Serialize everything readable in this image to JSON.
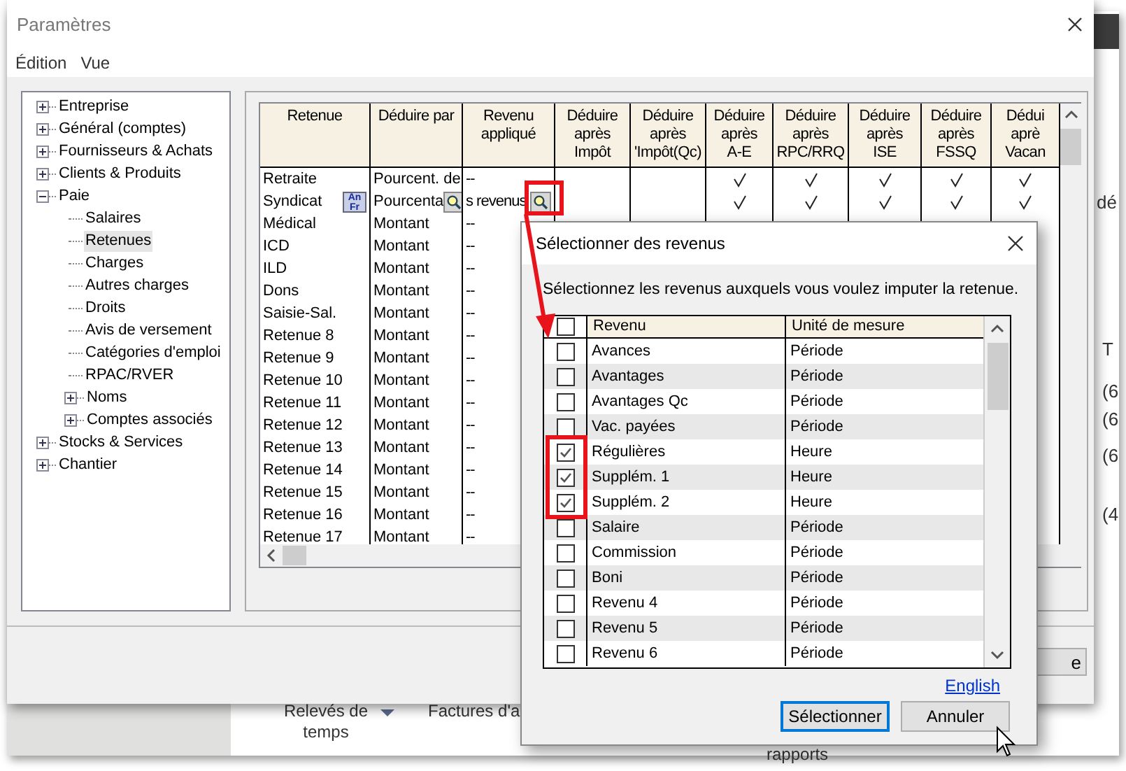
{
  "window": {
    "title": "Paramètres",
    "menu": [
      {
        "label": "Édition"
      },
      {
        "label": "Vue"
      }
    ]
  },
  "tree": [
    {
      "label": "Entreprise",
      "expanded": false,
      "selected": false
    },
    {
      "label": "Général (comptes)",
      "expanded": false,
      "selected": false
    },
    {
      "label": "Fournisseurs & Achats",
      "expanded": false,
      "selected": false
    },
    {
      "label": "Clients & Produits",
      "expanded": false,
      "selected": false
    },
    {
      "label": "Paie",
      "expanded": true,
      "selected": false,
      "children": [
        {
          "label": "Salaires",
          "selected": false
        },
        {
          "label": "Retenues",
          "selected": true
        },
        {
          "label": "Charges",
          "selected": false
        },
        {
          "label": "Autres charges",
          "selected": false
        },
        {
          "label": "Droits",
          "selected": false
        },
        {
          "label": "Avis de versement",
          "selected": false
        },
        {
          "label": "Catégories d'emploi",
          "selected": false
        },
        {
          "label": "RPAC/RVER",
          "selected": false
        },
        {
          "label": "Noms",
          "expanded": false,
          "selected": false
        },
        {
          "label": "Comptes associés",
          "expanded": false,
          "selected": false
        }
      ]
    },
    {
      "label": "Stocks & Services",
      "expanded": false,
      "selected": false
    },
    {
      "label": "Chantier",
      "expanded": false,
      "selected": false
    }
  ],
  "grid": {
    "columns": [
      [
        "Retenue"
      ],
      [
        "Déduire par"
      ],
      [
        "Revenu",
        "appliqué"
      ],
      [
        "Déduire",
        "après",
        "Impôt"
      ],
      [
        "Déduire",
        "après",
        "'Impôt(Qc)"
      ],
      [
        "Déduire",
        "après",
        "A-E"
      ],
      [
        "Déduire",
        "après",
        "RPC/RRQ"
      ],
      [
        "Déduire",
        "après",
        "ISE"
      ],
      [
        "Déduire",
        "après",
        "FSSQ"
      ],
      [
        "Dédui",
        "aprè",
        "Vacan"
      ]
    ],
    "rows": [
      {
        "retenue": "Retraite",
        "deduire_par": "Pourcent. de",
        "revenu": "--",
        "checks": [
          false,
          false,
          true,
          true,
          true,
          true,
          true
        ]
      },
      {
        "retenue": "Syndicat",
        "badge": [
          "An",
          "Fr"
        ],
        "deduire_par": "Pourcenta",
        "deduire_lookup": true,
        "revenu": "s revenus",
        "revenu_lookup": true,
        "checks": [
          false,
          false,
          true,
          true,
          true,
          true,
          true
        ]
      },
      {
        "retenue": "Médical",
        "deduire_par": "Montant",
        "revenu": "--"
      },
      {
        "retenue": "ICD",
        "deduire_par": "Montant",
        "revenu": "--"
      },
      {
        "retenue": "ILD",
        "deduire_par": "Montant",
        "revenu": "--"
      },
      {
        "retenue": "Dons",
        "deduire_par": "Montant",
        "revenu": "--"
      },
      {
        "retenue": "Saisie-Sal.",
        "deduire_par": "Montant",
        "revenu": "--"
      },
      {
        "retenue": "Retenue 8",
        "deduire_par": "Montant",
        "revenu": "--"
      },
      {
        "retenue": "Retenue 9",
        "deduire_par": "Montant",
        "revenu": "--"
      },
      {
        "retenue": "Retenue 10",
        "deduire_par": "Montant",
        "revenu": "--"
      },
      {
        "retenue": "Retenue 11",
        "deduire_par": "Montant",
        "revenu": "--"
      },
      {
        "retenue": "Retenue 12",
        "deduire_par": "Montant",
        "revenu": "--"
      },
      {
        "retenue": "Retenue 13",
        "deduire_par": "Montant",
        "revenu": "--"
      },
      {
        "retenue": "Retenue 14",
        "deduire_par": "Montant",
        "revenu": "--"
      },
      {
        "retenue": "Retenue 15",
        "deduire_par": "Montant",
        "revenu": "--"
      },
      {
        "retenue": "Retenue 16",
        "deduire_par": "Montant",
        "revenu": "--"
      },
      {
        "retenue": "Retenue 17",
        "deduire_par": "Montant",
        "revenu": "--"
      }
    ]
  },
  "bottom_button": "e",
  "dialog": {
    "title": "Sélectionner des revenus",
    "instruction": "Sélectionnez les revenus auxquels vous voulez imputer la retenue.",
    "columns": [
      "Revenu",
      "Unité de mesure"
    ],
    "header_checked": false,
    "rows": [
      {
        "revenu": "Avances",
        "unite": "Période",
        "checked": false
      },
      {
        "revenu": "Avantages",
        "unite": "Période",
        "checked": false
      },
      {
        "revenu": "Avantages Qc",
        "unite": "Période",
        "checked": false
      },
      {
        "revenu": "Vac. payées",
        "unite": "Période",
        "checked": false
      },
      {
        "revenu": "Régulières",
        "unite": "Heure",
        "checked": true
      },
      {
        "revenu": "Supplém. 1",
        "unite": "Heure",
        "checked": true
      },
      {
        "revenu": "Supplém. 2",
        "unite": "Heure",
        "checked": true
      },
      {
        "revenu": "Salaire",
        "unite": "Période",
        "checked": false
      },
      {
        "revenu": "Commission",
        "unite": "Période",
        "checked": false
      },
      {
        "revenu": "Boni",
        "unite": "Période",
        "checked": false
      },
      {
        "revenu": "Revenu 4",
        "unite": "Période",
        "checked": false
      },
      {
        "revenu": "Revenu 5",
        "unite": "Période",
        "checked": false
      },
      {
        "revenu": "Revenu 6",
        "unite": "Période",
        "checked": false
      }
    ],
    "link": "English",
    "buttons": [
      {
        "label": "Sélectionner",
        "default": true
      },
      {
        "label": "Annuler",
        "default": false
      }
    ]
  },
  "background": {
    "toolbar": [
      {
        "label": "Relevés de temps",
        "dropdown": true
      },
      {
        "label": "Factures d'a",
        "dropdown": false
      }
    ],
    "footer_text": "rapports",
    "side_texts": [
      "dé",
      "T",
      "(6",
      "(6",
      "(6",
      "(4"
    ]
  }
}
